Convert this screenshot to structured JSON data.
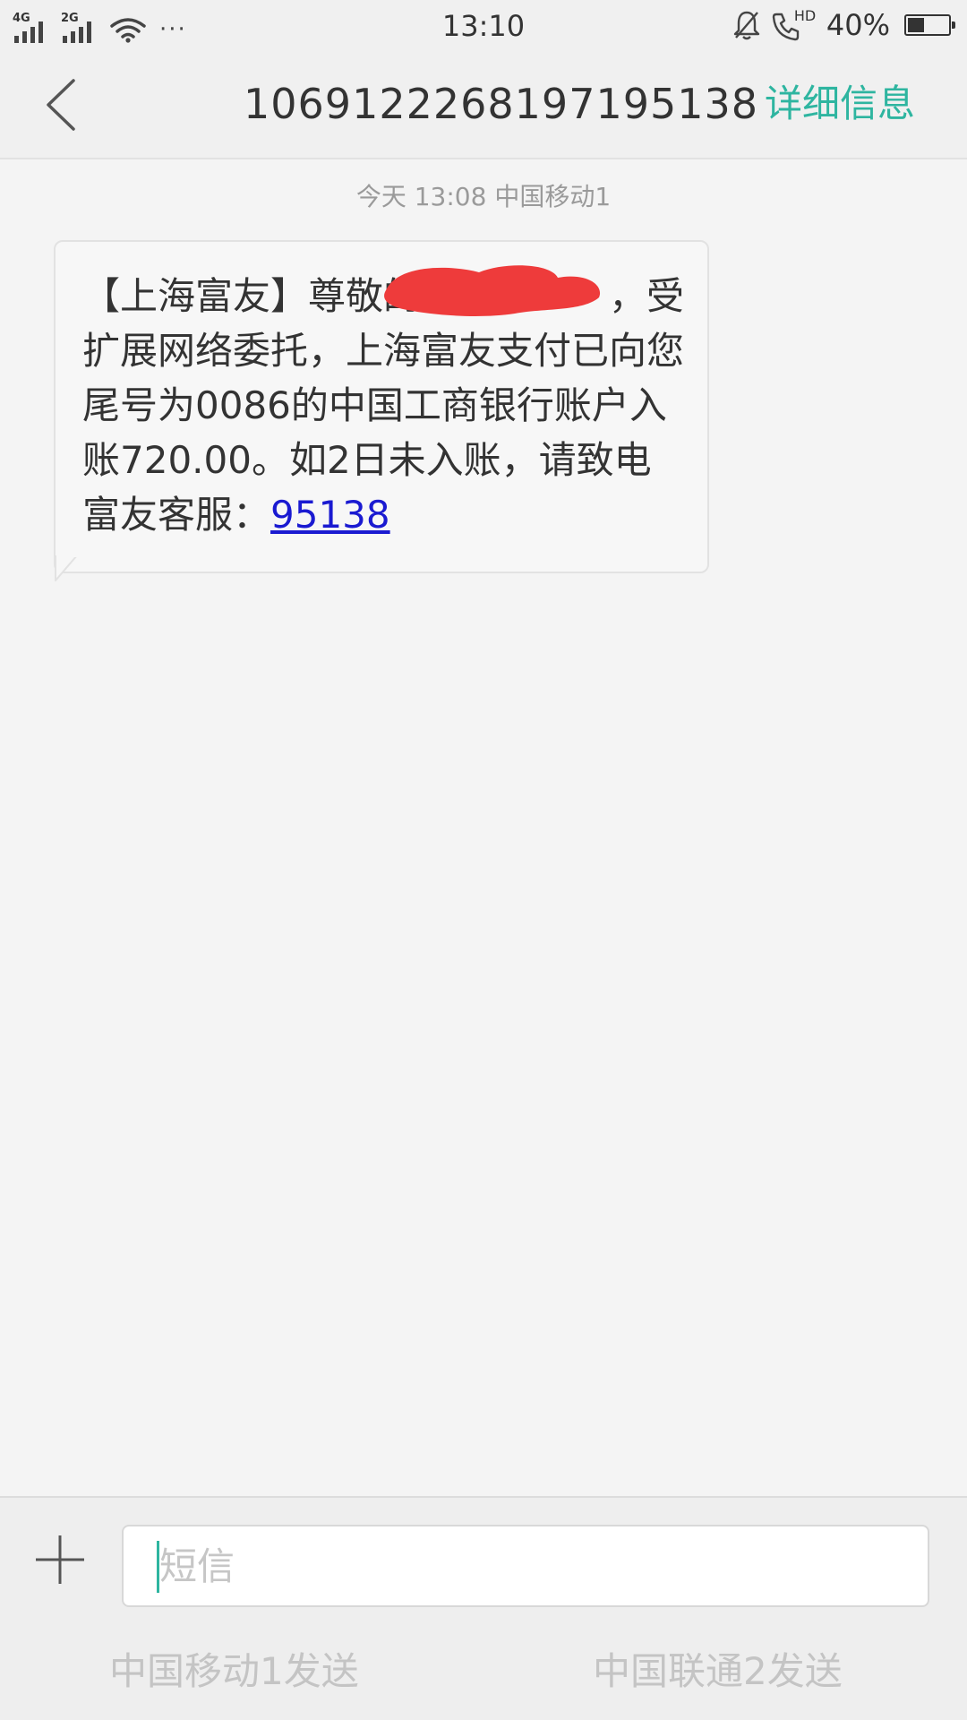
{
  "status_bar": {
    "network_1": "4G",
    "network_2": "2G",
    "more": "···",
    "time": "13:10",
    "call_badge": "HD",
    "battery_percent": "40%",
    "battery_level": 0.4
  },
  "header": {
    "back_icon": "chevron-left-icon",
    "title": "1069122268197195138",
    "details_label": "详细信息"
  },
  "conversation": {
    "timestamp": "今天  13:08  中国移动1",
    "message": {
      "text": "【上海富友】尊敬的　　　　　，受扩展网络委托，上海富友支付已向您尾号为0086的中国工商银行账户入账720.00。如2日未入账，请致电富友客服：",
      "link": "95138",
      "redaction_color": "#ee3b3b"
    }
  },
  "composer": {
    "add_icon": "plus-icon",
    "placeholder": "短信",
    "send_sim1": "中国移动1发送",
    "send_sim2": "中国联通2发送"
  },
  "colors": {
    "accent": "#2eb5a0",
    "link": "#1a1ad1",
    "background": "#f4f4f4"
  }
}
